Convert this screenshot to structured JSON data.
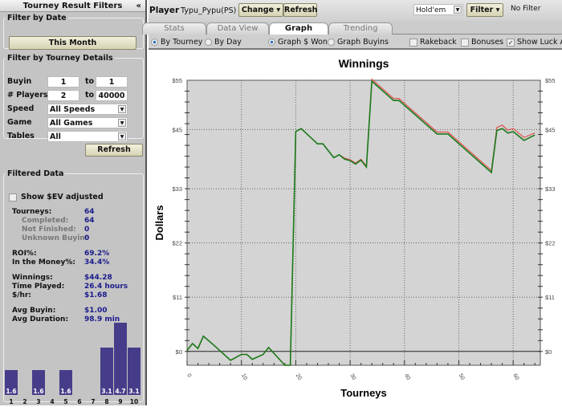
{
  "left_panel": {
    "title": "Tourney Result Filters",
    "collapse_icon": "«",
    "date_group": {
      "legend": "Filter by Date",
      "button": "This Month"
    },
    "details_group": {
      "legend": "Filter by Tourney Details",
      "buyin_label": "Buyin",
      "buyin_from": "1",
      "to1": "to",
      "buyin_to": "1",
      "players_label": "# Players",
      "players_from": "2",
      "to2": "to",
      "players_to": "40000",
      "speed_label": "Speed",
      "speed_value": "All Speeds",
      "game_label": "Game",
      "game_value": "All Games",
      "tables_label": "Tables",
      "tables_value": "All"
    },
    "refresh_button": "Refresh",
    "filtered": {
      "legend": "Filtered Data",
      "ev_checkbox": "Show $EV adjusted",
      "rows": [
        {
          "k": "Tourneys:",
          "v": "64"
        },
        {
          "k": "Completed:",
          "v": "64"
        },
        {
          "k": "Not Finished:",
          "v": "0"
        },
        {
          "k": "Unknown Buyin:",
          "v": "0"
        },
        {
          "k": "ROI%:",
          "v": "69.2%"
        },
        {
          "k": "In the Money%:",
          "v": "34.4%"
        },
        {
          "k": "Winnings:",
          "v": "$44.28"
        },
        {
          "k": "Time Played:",
          "v": "26.4 hours"
        },
        {
          "k": "$/hr:",
          "v": "$1.68"
        },
        {
          "k": "Avg Buyin:",
          "v": "$1.00"
        },
        {
          "k": "Avg Duration:",
          "v": "98.9 min"
        }
      ],
      "histogram": {
        "labels": [
          "1",
          "2",
          "3",
          "4",
          "5",
          "6",
          "7",
          "8",
          "9",
          "10"
        ],
        "values": [
          1.6,
          0,
          1.6,
          0,
          1.6,
          0,
          0,
          3.1,
          4.7,
          3.1
        ],
        "value_labels": [
          "1.6",
          "",
          "1.6",
          "",
          "1.6",
          "",
          "",
          "3.1",
          "4.7",
          "3.1"
        ]
      }
    }
  },
  "header": {
    "player_label": "Player",
    "player_name": "Typu_Pypu(PS)",
    "change": "Change",
    "refresh": "Refresh",
    "game_select": "Hold'em",
    "filter": "Filter",
    "filter_status": "No Filter"
  },
  "tabs": [
    {
      "label": "Stats"
    },
    {
      "label": "Data View"
    },
    {
      "label": "Graph",
      "active": true
    },
    {
      "label": "Trending"
    }
  ],
  "options": {
    "by_tourney": "By Tourney",
    "by_day": "By Day",
    "graph_won": "Graph $ Won",
    "graph_buyins": "Graph Buyins",
    "rakeback": "Rakeback",
    "bonuses": "Bonuses",
    "luck": "Show Luck Adj"
  },
  "chart_data": {
    "type": "line",
    "title": "Winnings",
    "xlabel": "Tourneys",
    "ylabel": "Dollars",
    "xlim": [
      0,
      65
    ],
    "ylim": [
      -2.8,
      55
    ],
    "xticks": [
      0,
      10,
      20,
      30,
      40,
      50,
      60
    ],
    "yticks": [
      0,
      11,
      22,
      33,
      45,
      55
    ],
    "ytick_labels": [
      "$0",
      "$11",
      "$22",
      "$33",
      "$45",
      "$55"
    ],
    "grid": true,
    "series": [
      {
        "name": "Winnings",
        "color": "#1a7a1a",
        "points": [
          [
            0,
            0.2
          ],
          [
            1,
            1.6
          ],
          [
            2,
            0.6
          ],
          [
            3,
            3.1
          ],
          [
            5,
            1.2
          ],
          [
            8,
            -1.8
          ],
          [
            10,
            -0.6
          ],
          [
            11,
            -0.6
          ],
          [
            12,
            -1.6
          ],
          [
            14,
            -0.6
          ],
          [
            15,
            0.8
          ],
          [
            18,
            -2.8
          ],
          [
            19,
            -2.8
          ],
          [
            20,
            44.6
          ],
          [
            21,
            45.2
          ],
          [
            24,
            42.1
          ],
          [
            25,
            42.1
          ],
          [
            27,
            39.3
          ],
          [
            28,
            39.9
          ],
          [
            29,
            39.0
          ],
          [
            30,
            38.7
          ],
          [
            31,
            38.0
          ],
          [
            32,
            38.8
          ],
          [
            33,
            37.4
          ],
          [
            34,
            54.8
          ],
          [
            38,
            50.9
          ],
          [
            39,
            50.9
          ],
          [
            46,
            44.1
          ],
          [
            48,
            44.1
          ],
          [
            56,
            36.3
          ],
          [
            57,
            44.8
          ],
          [
            58,
            45.2
          ],
          [
            59,
            44.3
          ],
          [
            60,
            44.6
          ],
          [
            62,
            42.8
          ],
          [
            64,
            43.9
          ]
        ]
      },
      {
        "name": "Luck Adjusted",
        "color": "#e05050",
        "points": [
          [
            0,
            0.2
          ],
          [
            1,
            1.6
          ],
          [
            2,
            0.6
          ],
          [
            3,
            3.1
          ],
          [
            5,
            1.2
          ],
          [
            8,
            -1.8
          ],
          [
            10,
            -0.6
          ],
          [
            11,
            -0.6
          ],
          [
            12,
            -1.6
          ],
          [
            14,
            -0.6
          ],
          [
            15,
            0.8
          ],
          [
            18,
            -2.8
          ],
          [
            19,
            -2.8
          ],
          [
            20,
            44.6
          ],
          [
            21,
            45.2
          ],
          [
            24,
            42.1
          ],
          [
            25,
            42.1
          ],
          [
            27,
            39.3
          ],
          [
            28,
            39.9
          ],
          [
            29,
            39.2
          ],
          [
            30,
            38.9
          ],
          [
            31,
            38.2
          ],
          [
            32,
            39.0
          ],
          [
            33,
            37.6
          ],
          [
            34,
            55.2
          ],
          [
            38,
            51.3
          ],
          [
            39,
            51.3
          ],
          [
            46,
            44.5
          ],
          [
            48,
            44.5
          ],
          [
            56,
            36.7
          ],
          [
            57,
            45.4
          ],
          [
            58,
            45.9
          ],
          [
            59,
            44.9
          ],
          [
            60,
            45.2
          ],
          [
            62,
            43.4
          ],
          [
            64,
            44.3
          ]
        ]
      }
    ]
  }
}
